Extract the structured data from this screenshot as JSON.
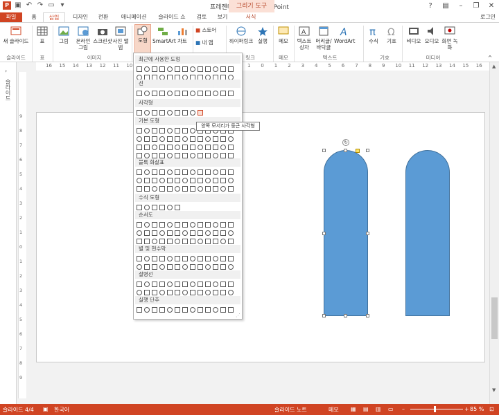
{
  "window": {
    "title": "프레젠테이션1 - PowerPoint",
    "context_title": "그리기 도구",
    "login": "로그인"
  },
  "tabs": [
    "파일",
    "홈",
    "삽입",
    "디자인",
    "전환",
    "애니메이션",
    "슬라이드 쇼",
    "검토",
    "보기",
    "서식"
  ],
  "ribbon": {
    "buttons": [
      "새 슬라이드",
      "표",
      "그림",
      "온라인 그림",
      "스크린샷",
      "사진 앨범",
      "도형",
      "SmartArt",
      "차트",
      "스토어",
      "내 앱",
      "하이퍼링크",
      "실행",
      "메모",
      "텍스트 상자",
      "머리글/바닥글",
      "WordArt",
      "수식",
      "기호",
      "비디오",
      "오디오",
      "화면 녹화"
    ],
    "groups": [
      "슬라이드",
      "표",
      "이미지",
      "링크",
      "메모",
      "텍스트",
      "기호",
      "미디어"
    ]
  },
  "dropdown": {
    "sections": [
      "최근에 사용한 도형",
      "선",
      "사각형",
      "기본 도형",
      "블록 화살표",
      "수식 도형",
      "순서도",
      "별 및 현수막",
      "설명선",
      "실행 단추"
    ],
    "tooltip": "양쪽 모서리가 둥근 사각형"
  },
  "ruler": {
    "h": [
      "16",
      "15",
      "14",
      "13",
      "12",
      "11",
      "10",
      "9",
      "8",
      "7",
      "6",
      "5",
      "4",
      "3",
      "2",
      "1",
      "0",
      "1",
      "2",
      "3",
      "4",
      "5",
      "6",
      "7",
      "8",
      "9",
      "10",
      "11",
      "12",
      "13",
      "14",
      "15",
      "16"
    ],
    "v": [
      "9",
      "8",
      "7",
      "6",
      "5",
      "4",
      "3",
      "2",
      "1",
      "0",
      "1",
      "2",
      "3",
      "4",
      "5",
      "6",
      "7",
      "8",
      "9"
    ]
  },
  "left_pane": {
    "label": "슬라이드"
  },
  "status": {
    "slide": "슬라이드 4/4",
    "lang": "한국어",
    "notes": "슬라이드 노트",
    "comments": "메모",
    "zoom": "85 %"
  },
  "colors": {
    "accent": "#d04423",
    "shape_fill": "#5b9bd5"
  }
}
